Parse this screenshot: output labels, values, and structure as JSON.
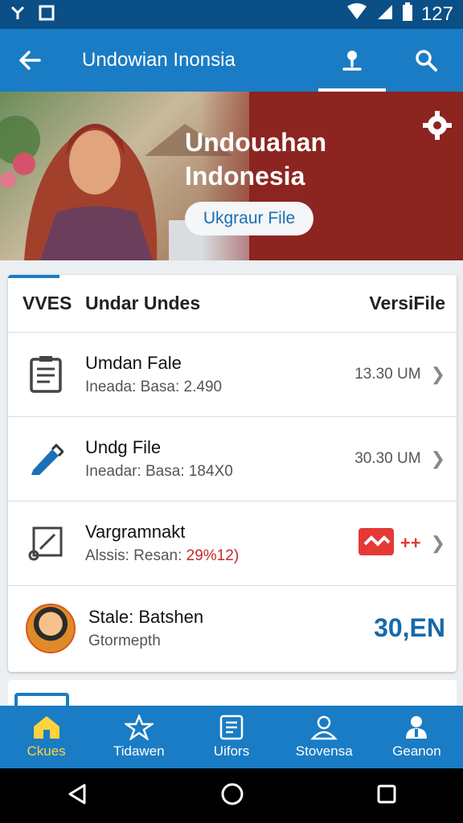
{
  "status_bar": {
    "time": "127",
    "icons": [
      "signal-icon",
      "wifi-icon",
      "battery-icon"
    ]
  },
  "app_bar": {
    "title": "Undowian Inonsia",
    "back_icon": "arrow-left-icon",
    "actions": [
      "profile-icon",
      "search-icon"
    ]
  },
  "banner": {
    "headline_line1": "Undouahan",
    "headline_line2": "Indonesia",
    "button_label": "Ukgraur File",
    "settings_icon": "gear-icon"
  },
  "list": {
    "header_col1": "VVES",
    "header_col2": "Undar Undes",
    "header_col3": "VersiFile",
    "rows": [
      {
        "icon": "document-icon",
        "title": "Umdan Fale",
        "subtitle": "Ineada: Basa: 2.490",
        "value": "13.30 UM"
      },
      {
        "icon": "pen-icon",
        "title": "Undg File",
        "subtitle": "Ineadar: Basa: 184X0",
        "value": "30.30 UM"
      },
      {
        "icon": "edit-file-icon",
        "title": "Vargramnakt",
        "subtitle_prefix": "Alssis: Resan:",
        "subtitle_highlight": "29%12)",
        "badge": "++"
      },
      {
        "icon": "avatar",
        "title": "Stale: Batshen",
        "subtitle": "Gtormepth",
        "amount": "30,EN"
      }
    ]
  },
  "bottom_nav": [
    {
      "label": "Ckues",
      "icon": "home-icon",
      "active": true
    },
    {
      "label": "Tidawen",
      "icon": "star-icon",
      "active": false
    },
    {
      "label": "Uifors",
      "icon": "file-icon",
      "active": false
    },
    {
      "label": "Stovensa",
      "icon": "person-icon",
      "active": false
    },
    {
      "label": "Geanon",
      "icon": "account-icon",
      "active": false
    }
  ],
  "colors": {
    "primary": "#1a7cc4",
    "status_bar": "#0a4f86",
    "banner": "#8c2420",
    "active_nav": "#ffd23f"
  }
}
